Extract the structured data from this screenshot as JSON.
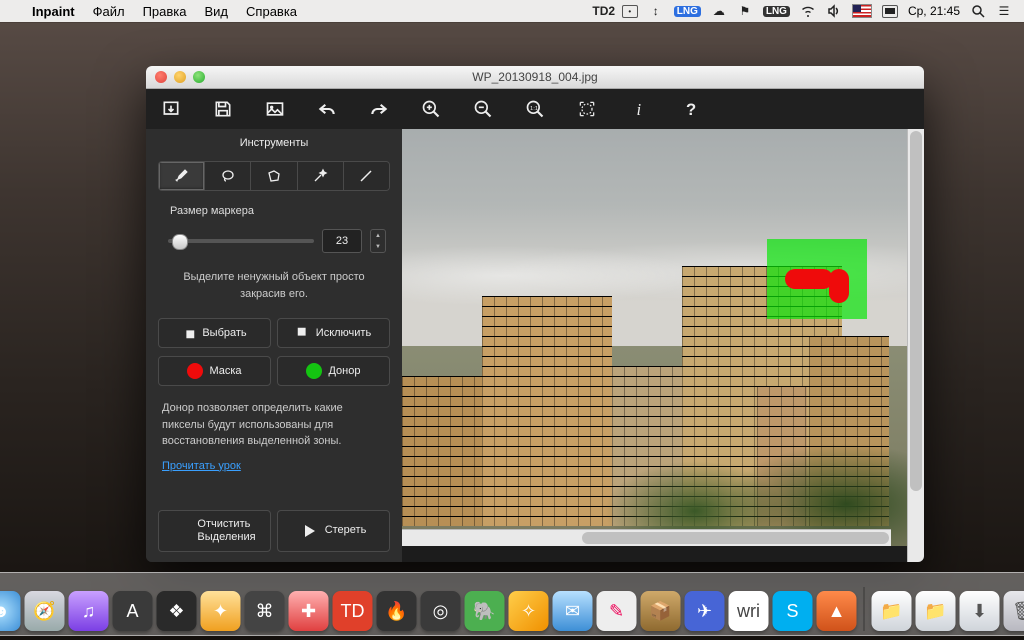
{
  "menubar": {
    "apple": "",
    "app": "Inpaint",
    "items": [
      "Файл",
      "Правка",
      "Вид",
      "Справка"
    ],
    "right": {
      "td": "TD2",
      "lng": "LNG",
      "date": "Ср, 21:45"
    }
  },
  "window": {
    "filename": "WP_20130918_004.jpg"
  },
  "sidebar": {
    "tools_title": "Инструменты",
    "marker_label": "Размер маркера",
    "marker_value": "23",
    "hint1": "Выделите ненужный объект просто закрасив его.",
    "select_label": "Выбрать",
    "exclude_label": "Исключить",
    "mask_label": "Маска",
    "donor_label": "Донор",
    "para": "Донор позволяет определить какие пикселы будут использованы для восстановления выделенной зоны.",
    "link": "Прочитать урок",
    "clear_line1": "Отчистить",
    "clear_line2": "Выделения",
    "erase_label": "Стереть"
  },
  "colors": {
    "mask": "#ef0b0b",
    "donor": "#14c411"
  }
}
